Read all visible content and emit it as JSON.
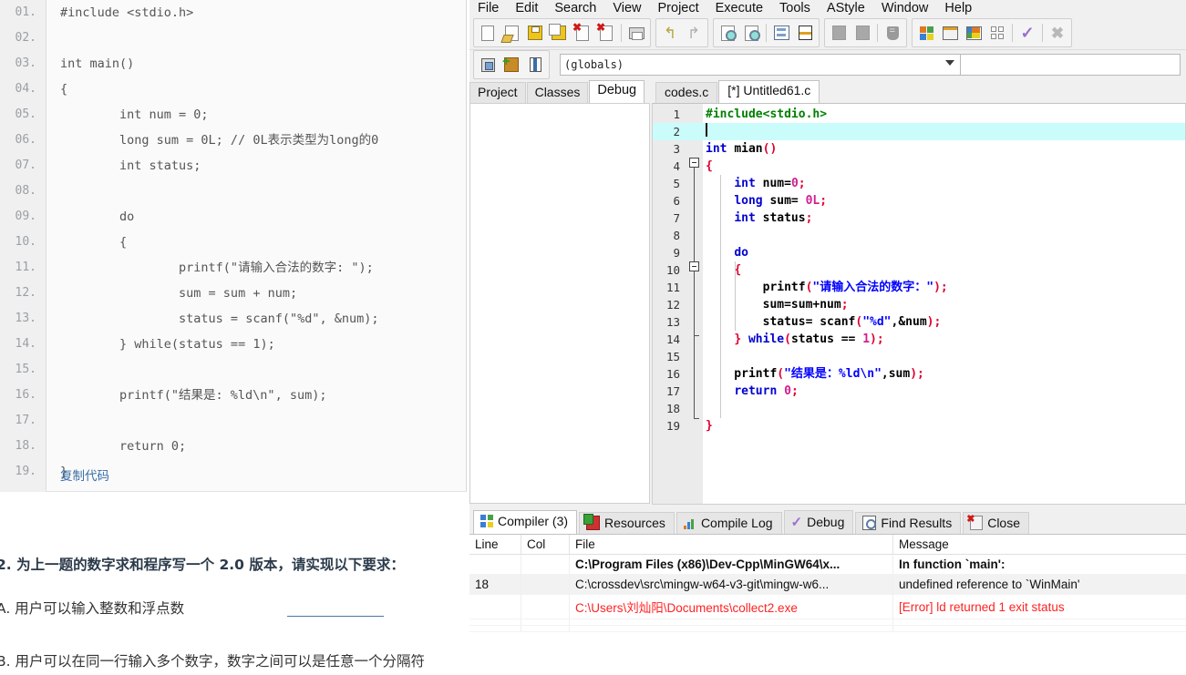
{
  "left_article": {
    "code_block": {
      "lines": [
        {
          "no": "01.",
          "text": "#include <stdio.h>"
        },
        {
          "no": "02.",
          "text": ""
        },
        {
          "no": "03.",
          "text": "int main()"
        },
        {
          "no": "04.",
          "text": "{"
        },
        {
          "no": "05.",
          "text": "        int num = 0;"
        },
        {
          "no": "06.",
          "text": "        long sum = 0L; // 0L表示类型为long的0"
        },
        {
          "no": "07.",
          "text": "        int status;"
        },
        {
          "no": "08.",
          "text": ""
        },
        {
          "no": "09.",
          "text": "        do"
        },
        {
          "no": "10.",
          "text": "        {"
        },
        {
          "no": "11.",
          "text": "                printf(\"请输入合法的数字: \");"
        },
        {
          "no": "12.",
          "text": "                sum = sum + num;"
        },
        {
          "no": "13.",
          "text": "                status = scanf(\"%d\", &num);"
        },
        {
          "no": "14.",
          "text": "        } while(status == 1);"
        },
        {
          "no": "15.",
          "text": ""
        },
        {
          "no": "16.",
          "text": "        printf(\"结果是: %ld\\n\", sum);"
        },
        {
          "no": "17.",
          "text": ""
        },
        {
          "no": "18.",
          "text": "        return 0;"
        },
        {
          "no": "19.",
          "text": "}"
        }
      ],
      "copy_label": "复制代码"
    },
    "question_title": "2. 为上一题的数字求和程序写一个 2.0 版本，请实现以下要求：",
    "item_a": "A. 用户可以输入整数和浮点数",
    "item_b": "B. 用户可以在同一行输入多个数字，数字之间可以是任意一个分隔符"
  },
  "ide": {
    "menu": [
      "File",
      "Edit",
      "Search",
      "View",
      "Project",
      "Execute",
      "Tools",
      "AStyle",
      "Window",
      "Help"
    ],
    "toolbar": {
      "groups": [
        {
          "buttons": [
            {
              "icon": "new-file-icon"
            },
            {
              "icon": "open-file-icon"
            },
            {
              "icon": "save-file-icon"
            },
            {
              "icon": "save-all-icon"
            },
            {
              "icon": "close-file-icon"
            },
            {
              "icon": "close-all-icon"
            },
            {
              "icon": "separator"
            },
            {
              "icon": "print-icon"
            }
          ]
        },
        {
          "buttons": [
            {
              "icon": "undo-icon"
            },
            {
              "icon": "redo-icon"
            }
          ]
        },
        {
          "buttons": [
            {
              "icon": "find-icon"
            },
            {
              "icon": "find-next-icon"
            },
            {
              "icon": "separator"
            },
            {
              "icon": "replace-icon"
            },
            {
              "icon": "goto-line-icon"
            }
          ]
        },
        {
          "buttons": [
            {
              "icon": "back-icon"
            },
            {
              "icon": "forward-icon"
            },
            {
              "icon": "separator"
            },
            {
              "icon": "insert-icon"
            }
          ]
        },
        {
          "buttons": [
            {
              "icon": "compile-icon"
            },
            {
              "icon": "run-icon"
            },
            {
              "icon": "compile-run-icon"
            },
            {
              "icon": "rebuild-all-icon"
            },
            {
              "icon": "separator"
            },
            {
              "icon": "syntax-check-icon"
            },
            {
              "icon": "separator"
            },
            {
              "icon": "stop-execution-icon"
            }
          ]
        }
      ]
    },
    "toolbar2": {
      "buttons": [
        {
          "icon": "new-project-icon"
        },
        {
          "icon": "add-to-project-icon"
        },
        {
          "icon": "project-options-icon"
        }
      ],
      "scope_value": "(globals)",
      "scope_dropdown_icon": "chevron-down-icon"
    },
    "left_dock": {
      "tabs": [
        {
          "label": "Project",
          "active": false
        },
        {
          "label": "Classes",
          "active": false
        },
        {
          "label": "Debug",
          "active": true
        }
      ]
    },
    "editor": {
      "tabs": [
        {
          "label": "codes.c",
          "active": false
        },
        {
          "label": "[*] Untitled61.c",
          "active": true
        }
      ],
      "current_line": 2,
      "lines": [
        {
          "no": "1",
          "segments": [
            {
              "t": "#include<stdio.h>",
              "c": "pre"
            }
          ],
          "indentline": false
        },
        {
          "no": "2",
          "segments": [],
          "caret": true,
          "indentline": false
        },
        {
          "no": "3",
          "segments": [
            {
              "t": "int ",
              "c": "kw"
            },
            {
              "t": "mian",
              "c": "plain"
            },
            {
              "t": "()",
              "c": "pn"
            }
          ],
          "indentline": false
        },
        {
          "no": "4",
          "segments": [
            {
              "t": "{",
              "c": "pn"
            }
          ],
          "fold": "open",
          "indentline": false
        },
        {
          "no": "5",
          "segments": [
            {
              "t": "    ",
              "c": "plain"
            },
            {
              "t": "int ",
              "c": "kw"
            },
            {
              "t": "num=",
              "c": "plain"
            },
            {
              "t": "0",
              "c": "num"
            },
            {
              "t": ";",
              "c": "pn"
            }
          ],
          "indentline": true
        },
        {
          "no": "6",
          "segments": [
            {
              "t": "    ",
              "c": "plain"
            },
            {
              "t": "long ",
              "c": "kw"
            },
            {
              "t": "sum= ",
              "c": "plain"
            },
            {
              "t": "0L",
              "c": "num"
            },
            {
              "t": ";",
              "c": "pn"
            }
          ],
          "indentline": true
        },
        {
          "no": "7",
          "segments": [
            {
              "t": "    ",
              "c": "plain"
            },
            {
              "t": "int ",
              "c": "kw"
            },
            {
              "t": "status",
              "c": "plain"
            },
            {
              "t": ";",
              "c": "pn"
            }
          ],
          "indentline": true
        },
        {
          "no": "8",
          "segments": [],
          "indentline": true
        },
        {
          "no": "9",
          "segments": [
            {
              "t": "    ",
              "c": "plain"
            },
            {
              "t": "do",
              "c": "kw"
            }
          ],
          "indentline": true
        },
        {
          "no": "10",
          "segments": [
            {
              "t": "    ",
              "c": "plain"
            },
            {
              "t": "{",
              "c": "pn"
            }
          ],
          "fold": "open",
          "indentline": true
        },
        {
          "no": "11",
          "segments": [
            {
              "t": "        printf",
              "c": "plain"
            },
            {
              "t": "(",
              "c": "pn"
            },
            {
              "t": "\"请输入合法的数字：\"",
              "c": "str"
            },
            {
              "t": ");",
              "c": "pn"
            }
          ],
          "indentline": true
        },
        {
          "no": "12",
          "segments": [
            {
              "t": "        sum=sum+num",
              "c": "plain"
            },
            {
              "t": ";",
              "c": "pn"
            }
          ],
          "indentline": true
        },
        {
          "no": "13",
          "segments": [
            {
              "t": "        status= scanf",
              "c": "plain"
            },
            {
              "t": "(",
              "c": "pn"
            },
            {
              "t": "\"%d\"",
              "c": "str"
            },
            {
              "t": ",&num",
              "c": "plain"
            },
            {
              "t": ");",
              "c": "pn"
            }
          ],
          "indentline": true
        },
        {
          "no": "14",
          "segments": [
            {
              "t": "    ",
              "c": "plain"
            },
            {
              "t": "}",
              "c": "pn"
            },
            {
              "t": " while",
              "c": "kw"
            },
            {
              "t": "(",
              "c": "pn"
            },
            {
              "t": "status == ",
              "c": "plain"
            },
            {
              "t": "1",
              "c": "num"
            },
            {
              "t": ");",
              "c": "pn"
            }
          ],
          "foldtick": true,
          "indentline": true
        },
        {
          "no": "15",
          "segments": [],
          "indentline": true
        },
        {
          "no": "16",
          "segments": [
            {
              "t": "    printf",
              "c": "plain"
            },
            {
              "t": "(",
              "c": "pn"
            },
            {
              "t": "\"结果是：%ld\\n\"",
              "c": "str"
            },
            {
              "t": ",sum",
              "c": "plain"
            },
            {
              "t": ");",
              "c": "pn"
            }
          ],
          "indentline": true
        },
        {
          "no": "17",
          "segments": [
            {
              "t": "    ",
              "c": "plain"
            },
            {
              "t": "return ",
              "c": "kw"
            },
            {
              "t": "0",
              "c": "num"
            },
            {
              "t": ";",
              "c": "pn"
            }
          ],
          "indentline": true
        },
        {
          "no": "18",
          "segments": [],
          "indentline": true
        },
        {
          "no": "19",
          "segments": [
            {
              "t": "}",
              "c": "pn"
            }
          ],
          "foldend": true,
          "indentline": false
        }
      ]
    },
    "bottom_dock": {
      "tabs": [
        {
          "label": "Compiler (3)",
          "icon": "compiler-icon",
          "active": true
        },
        {
          "label": "Resources",
          "icon": "resources-icon",
          "active": false
        },
        {
          "label": "Compile Log",
          "icon": "compile-log-icon",
          "active": false
        },
        {
          "label": "Debug",
          "icon": "debug-check-icon",
          "active": false
        },
        {
          "label": "Find Results",
          "icon": "find-results-icon",
          "active": false
        },
        {
          "label": "Close",
          "icon": "close-panel-icon",
          "active": false
        }
      ],
      "results": {
        "columns": [
          "Line",
          "Col",
          "File",
          "Message"
        ],
        "rows": [
          {
            "line": "",
            "col": "",
            "file": "C:\\Program Files (x86)\\Dev-Cpp\\MinGW64\\x...",
            "message": "In function `main':",
            "style": "bold"
          },
          {
            "line": "18",
            "col": "",
            "file": "C:\\crossdev\\src\\mingw-w64-v3-git\\mingw-w6...",
            "message": "undefined reference to `WinMain'",
            "style": "selected"
          },
          {
            "line": "",
            "col": "",
            "file": "C:\\Users\\刘灿阳\\Documents\\collect2.exe",
            "message": "[Error] ld returned 1 exit status",
            "style": "error"
          },
          {
            "line": "",
            "col": "",
            "file": "",
            "message": "",
            "style": "empty"
          },
          {
            "line": "",
            "col": "",
            "file": "",
            "message": "",
            "style": "empty"
          }
        ]
      }
    }
  },
  "colors": {
    "accent_blue": "#3a6ea5",
    "error_red": "#ff2222",
    "current_line": "#cbfcfc",
    "keyword": "#0000d0",
    "string": "#0000ff",
    "preprocessor": "#008000",
    "number": "#d02090",
    "punctuation": "#e00030"
  }
}
